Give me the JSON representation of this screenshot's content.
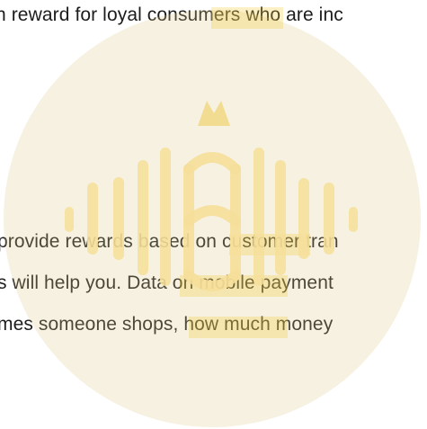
{
  "document": {
    "lines": [
      "n reward for loyal consumers who are inc",
      "provide rewards based on customer tran",
      "s will help you. Data on mobile payment",
      "mes someone shops, how much money"
    ]
  },
  "watermark": {
    "logo_text": "IBI",
    "icon": "crown-icon",
    "colors": {
      "circle": "#dcc789",
      "bars": "#f6df9a",
      "highlight": "#f4c832",
      "crown": "#f2d98a"
    }
  }
}
